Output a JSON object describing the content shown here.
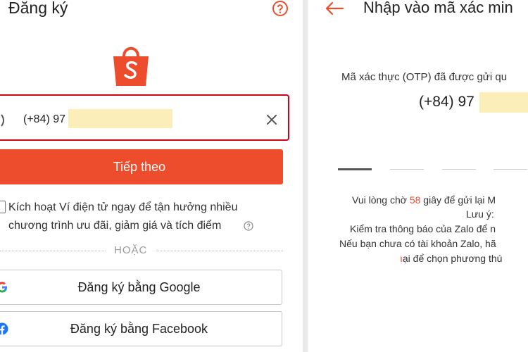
{
  "register": {
    "title": "Đăng ký",
    "phone_prefix": "(+84) 97",
    "next_label": "Tiếp theo",
    "promo_line1": "Kích hoạt Ví điện tử ngay để tận hưởng nhiều",
    "promo_line2": "chương trình ưu đãi, giảm giá và tích điểm",
    "or_label": "HOẶC",
    "google_label": "Đăng ký bằng Google",
    "facebook_label": "Đăng ký bằng Facebook",
    "icons": [
      "help-icon",
      "shopee-logo",
      "phone-icon",
      "clear-icon",
      "info-icon",
      "google-icon",
      "facebook-icon"
    ]
  },
  "otp": {
    "title": "Nhập vào mã xác min",
    "sent_message": "Mã xác thực (OTP) đã được gửi qu",
    "phone": "(+84) 97",
    "wait_prefix": "Vui lòng chờ ",
    "countdown": "58",
    "wait_suffix": " giây để gửi lại M",
    "note_label": "Lưu ý:",
    "note_line1": "Kiểm tra thông báo của Zalo để n",
    "note_line2": "Nếu bạn chưa có tài khoản Zalo, hã",
    "note_line3": "ại để chọn phương thú",
    "icons": [
      "back-arrow-icon"
    ]
  },
  "colors": {
    "brand": "#ee4d2d",
    "error_border": "#d0011b",
    "mask": "#fbeeb8"
  }
}
